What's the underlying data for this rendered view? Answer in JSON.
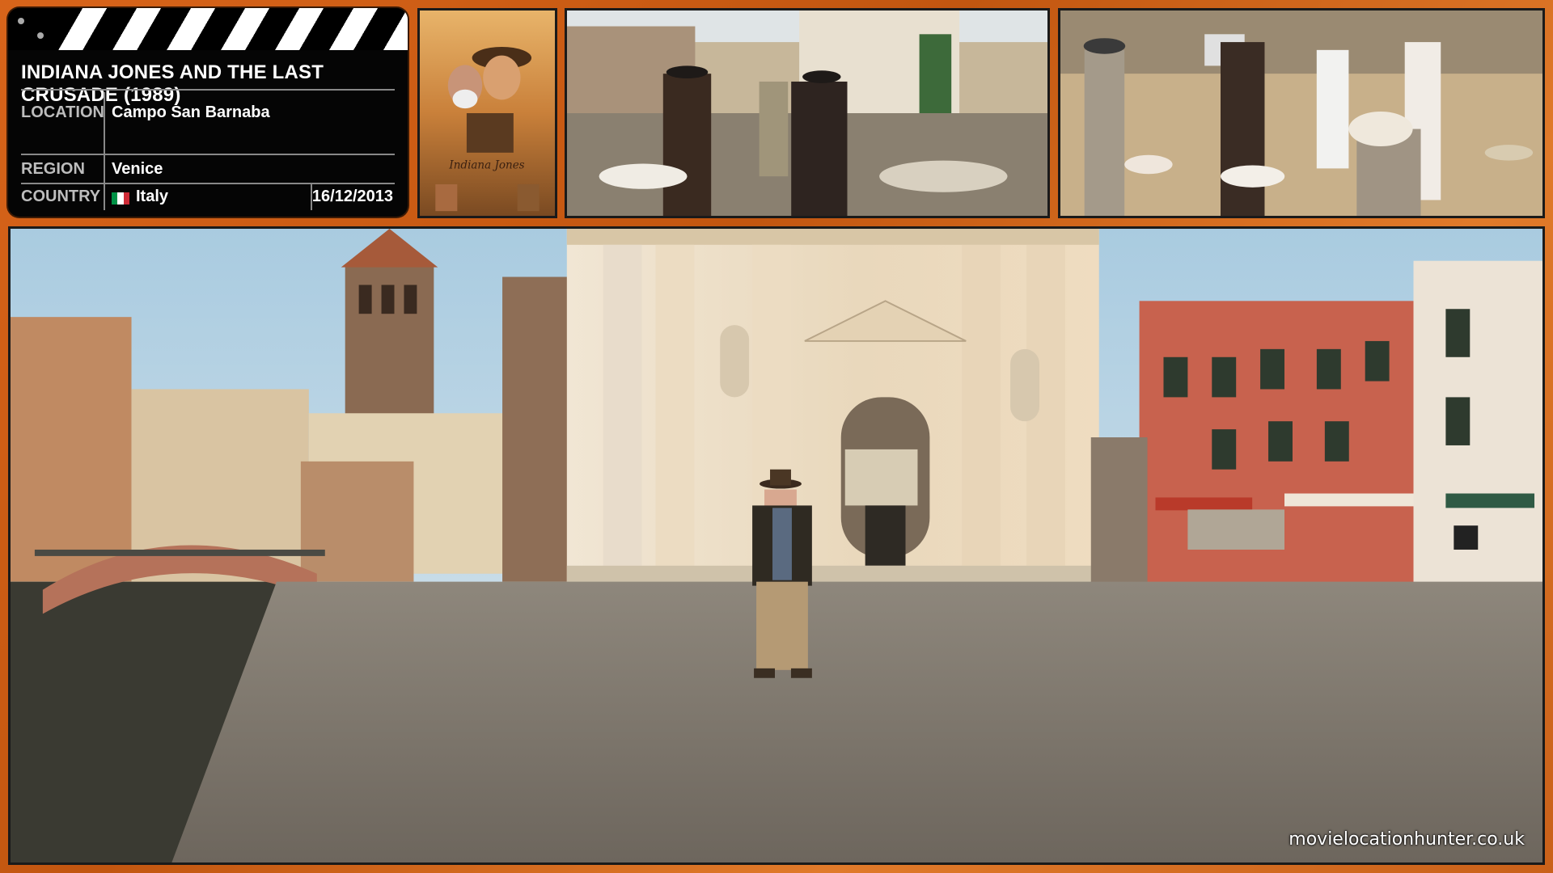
{
  "card": {
    "title": "INDIANA JONES AND THE LAST CRUSADE (1989)",
    "location_label": "LOCATION",
    "location_value": "Campo San Barnaba",
    "region_label": "REGION",
    "region_value": "Venice",
    "country_label": "COUNTRY",
    "country_value": "Italy",
    "date": "16/12/2013",
    "flag_colors": [
      "#009246",
      "#ffffff",
      "#ce2b37"
    ]
  },
  "watermark": "movielocationhunter.co.uk",
  "colors": {
    "background": "#d2661a",
    "card": "#050505",
    "label": "#bdbdbd"
  }
}
